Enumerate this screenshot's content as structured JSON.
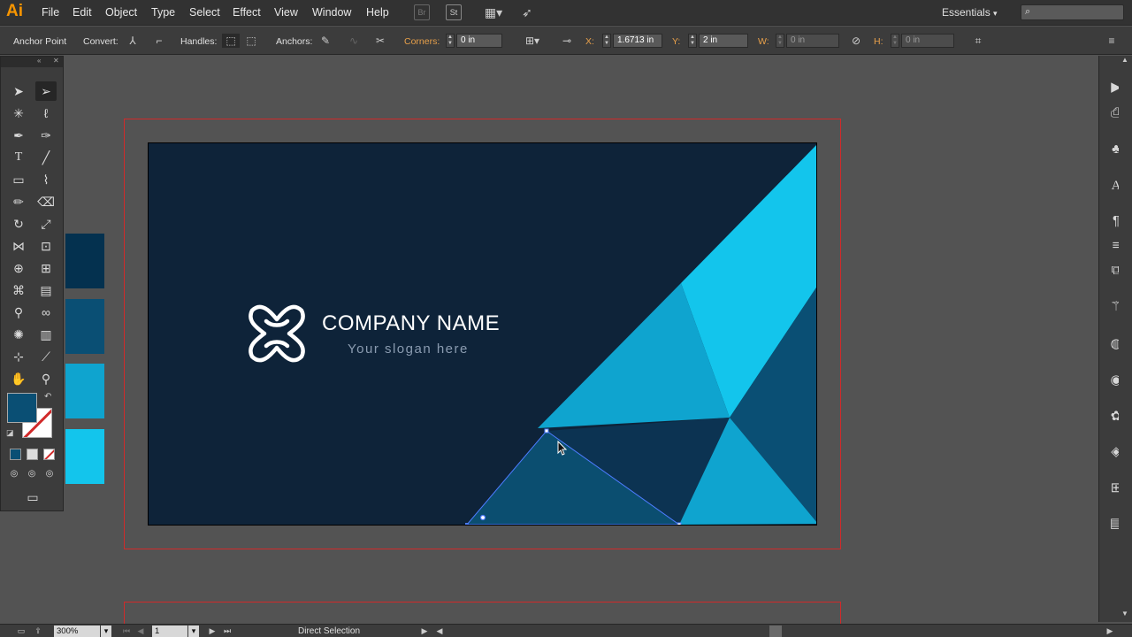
{
  "app": {
    "logo": "Ai"
  },
  "menu": [
    "File",
    "Edit",
    "Object",
    "Type",
    "Select",
    "Effect",
    "View",
    "Window",
    "Help"
  ],
  "menubar_icons": {
    "bridge": "Br",
    "stock": "St"
  },
  "workspace": {
    "label": "Essentials",
    "dropdown_icon": "▾"
  },
  "search": {
    "placeholder": ""
  },
  "control": {
    "anchor_point": "Anchor Point",
    "convert": "Convert:",
    "handles": "Handles:",
    "anchors": "Anchors:",
    "corners": "Corners:",
    "corners_value": "0 in",
    "x_label": "X:",
    "x_value": "1.6713 in",
    "y_label": "Y:",
    "y_value": "2 in",
    "w_label": "W:",
    "w_value": "0 in",
    "h_label": "H:",
    "h_value": "0 in"
  },
  "canvas": {
    "company_name": "COMPANY NAME",
    "slogan": "Your slogan here"
  },
  "colors": {
    "card_bg": "#0e2339",
    "cyan_light": "#13c5ec",
    "cyan_mid": "#0fa4cf",
    "teal_dark": "#0a4f74",
    "navy_mid": "#0c3352",
    "selected_triangle": "#0b4e70",
    "artboard_border": "#d12a2a",
    "selection": "#4d7cff",
    "fill_swatch": "#0a4f74"
  },
  "swatches": [
    "#04314f",
    "#0a4f74",
    "#0fa4cf",
    "#13c5ec"
  ],
  "status": {
    "zoom": "300%",
    "artboard_number": "1",
    "tool_name": "Direct Selection"
  }
}
